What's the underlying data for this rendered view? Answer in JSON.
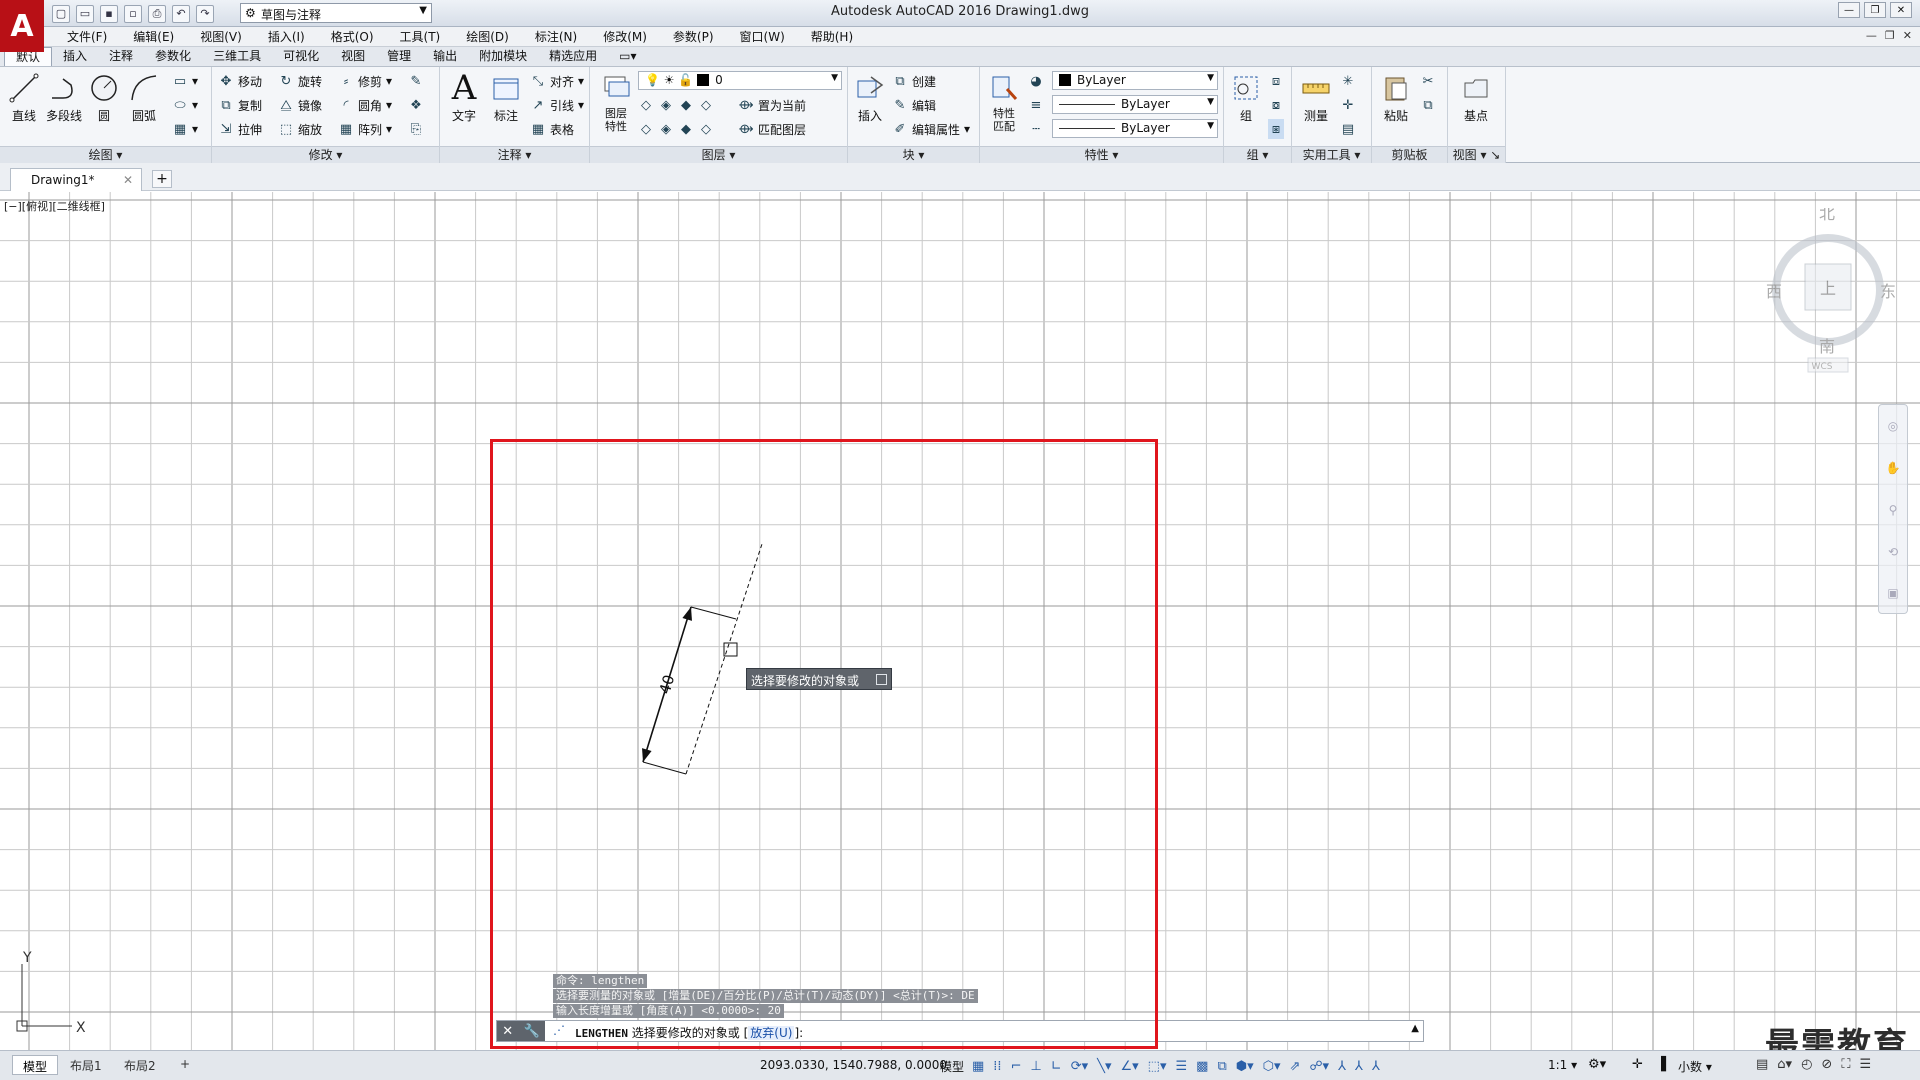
{
  "window": {
    "title": "Autodesk AutoCAD 2016    Drawing1.dwg",
    "workspace": "草图与注释",
    "logo": "A"
  },
  "menu": [
    "文件(F)",
    "编辑(E)",
    "视图(V)",
    "插入(I)",
    "格式(O)",
    "工具(T)",
    "绘图(D)",
    "标注(N)",
    "修改(M)",
    "参数(P)",
    "窗口(W)",
    "帮助(H)"
  ],
  "ribbon_tabs": [
    "默认",
    "插入",
    "注释",
    "参数化",
    "三维工具",
    "可视化",
    "视图",
    "管理",
    "输出",
    "附加模块",
    "精选应用"
  ],
  "ribbon": {
    "draw": {
      "title": "绘图",
      "line": "直线",
      "polyline": "多段线",
      "circle": "圆",
      "arc": "圆弧"
    },
    "modify": {
      "title": "修改",
      "move": "移动",
      "rotate": "旋转",
      "trim": "修剪",
      "copy": "复制",
      "mirror": "镜像",
      "fillet": "圆角",
      "stretch": "拉伸",
      "scale": "缩放",
      "array": "阵列"
    },
    "annotation": {
      "title": "注释",
      "text": "文字",
      "dimension": "标注",
      "align": "对齐",
      "leader": "引线",
      "table": "表格"
    },
    "layers": {
      "title": "图层",
      "props": "图层\n特性",
      "current_layer": "0",
      "set_current": "置为当前",
      "match_layer": "匹配图层"
    },
    "block": {
      "title": "块",
      "insert": "插入",
      "create": "创建",
      "edit": "编辑",
      "edit_attr": "编辑属性"
    },
    "properties": {
      "title": "特性",
      "match": "特性\n匹配",
      "color": "ByLayer",
      "linetype": "ByLayer",
      "lineweight": "ByLayer"
    },
    "groups": {
      "title": "组",
      "group": "组"
    },
    "utilities": {
      "title": "实用工具",
      "measure": "测量"
    },
    "clipboard": {
      "title": "剪贴板",
      "paste": "粘贴"
    },
    "view": {
      "title": "视图",
      "base": "基点"
    }
  },
  "file_tab": "Drawing1*",
  "viewport_label": "[−][俯视][二维线框]",
  "viewcube": {
    "north": "北",
    "south": "南",
    "east": "东",
    "west": "西",
    "face": "上",
    "wcs": "WCS"
  },
  "drawing": {
    "dimension_text": "40",
    "ucs_y": "Y",
    "ucs_x": "X"
  },
  "tooltip": "选择要修改的对象或",
  "command": {
    "history": [
      "命令:  lengthen",
      "选择要测量的对象或 [增量(DE)/百分比(P)/总计(T)/动态(DY)] <总计(T)>: DE",
      "输入长度增量或 [角度(A)] <0.0000>: 20"
    ],
    "name": "LENGTHEN",
    "prompt": " 选择要修改的对象或 [",
    "option": "放弃(U)",
    "suffix": "]:"
  },
  "status": {
    "layouts": [
      "模型",
      "布局1",
      "布局2"
    ],
    "coordinates": "2093.0330, 1540.7988, 0.0000",
    "model": "模型",
    "scale": "1:1",
    "units": "小数"
  },
  "watermark": "最需教育",
  "colors": {
    "highlight": "#e0151d",
    "grid_minor": "#c9c9c9",
    "grid_major": "#9a9a9a",
    "logo": "#b81016"
  }
}
